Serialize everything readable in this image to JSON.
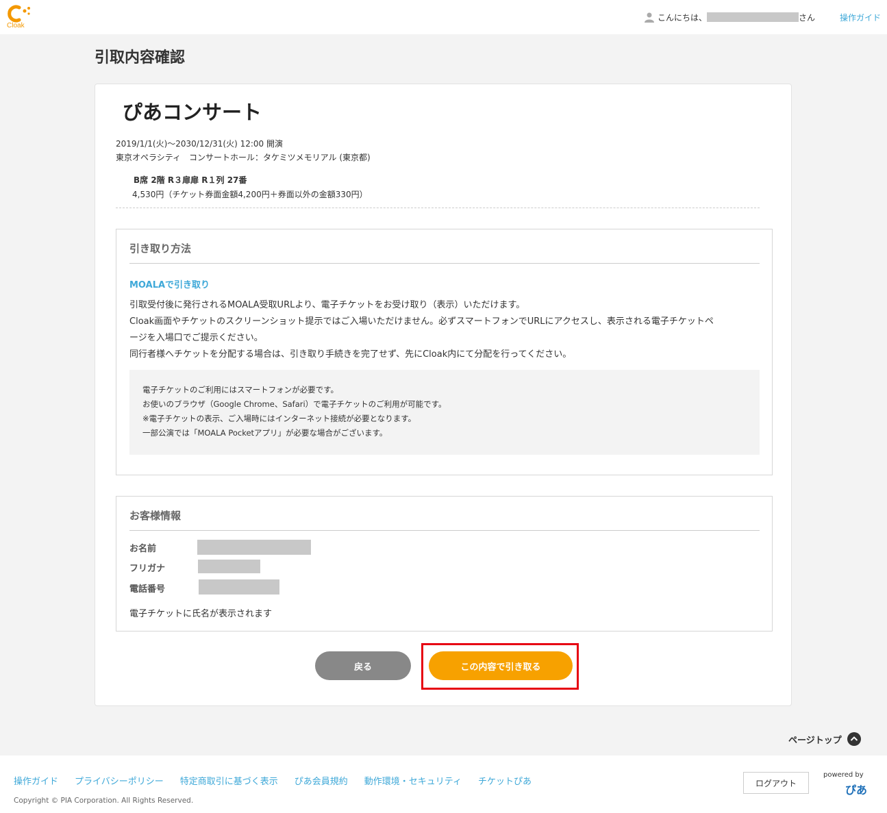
{
  "header": {
    "logo_text": "Cloak",
    "greeting_prefix": "こんにちは、",
    "greeting_suffix": "さん",
    "guide_link": "操作ガイド"
  },
  "page": {
    "title": "引取内容確認"
  },
  "event": {
    "title": "ぴあコンサート",
    "date": "2019/1/1(火)〜2030/12/31(火) 12:00 開演",
    "venue": "東京オペラシティ　コンサートホール：タケミツメモリアル (東京都)",
    "seat": "B席 2階 R３扉扉 R１列 27番",
    "price": "4,530円（チケット券面金額4,200円＋券面以外の金額330円）"
  },
  "pickup": {
    "heading": "引き取り方法",
    "method": "MOALAで引き取り",
    "line1": "引取受付後に発行されるMOALA受取URLより、電子チケットをお受け取り（表示）いただけます。",
    "line2": "Cloak画面やチケットのスクリーンショット提示ではご入場いただけません。必ずスマートフォンでURLにアクセスし、表示される電子チケットペ",
    "line3": "ージを入場口でご提示ください。",
    "line4": "同行者様へチケットを分配する場合は、引き取り手続きを完了せず、先にCloak内にて分配を行ってください。",
    "notes": [
      "電子チケットのご利用にはスマートフォンが必要です。",
      "お使いのブラウザ（Google Chrome、Safari）で電子チケットのご利用が可能です。",
      "※電子チケットの表示、ご入場時にはインターネット接続が必要となります。",
      "一部公演では「MOALA Pocketアプリ」が必要な場合がございます。"
    ]
  },
  "customer": {
    "heading": "お客様情報",
    "name_label": "お名前",
    "kana_label": "フリガナ",
    "phone_label": "電話番号",
    "note": "電子チケットに氏名が表示されます"
  },
  "buttons": {
    "back": "戻る",
    "confirm": "この内容で引き取る"
  },
  "page_top": "ページトップ",
  "footer": {
    "links": [
      "操作ガイド",
      "プライバシーポリシー",
      "特定商取引に基づく表示",
      "ぴあ会員規約",
      "動作環境・セキュリティ",
      "チケットぴあ"
    ],
    "copyright": "Copyright © PIA Corporation. All Rights Reserved.",
    "logout": "ログアウト",
    "powered_by": "powered by",
    "pia_logo": "ぴあ"
  }
}
